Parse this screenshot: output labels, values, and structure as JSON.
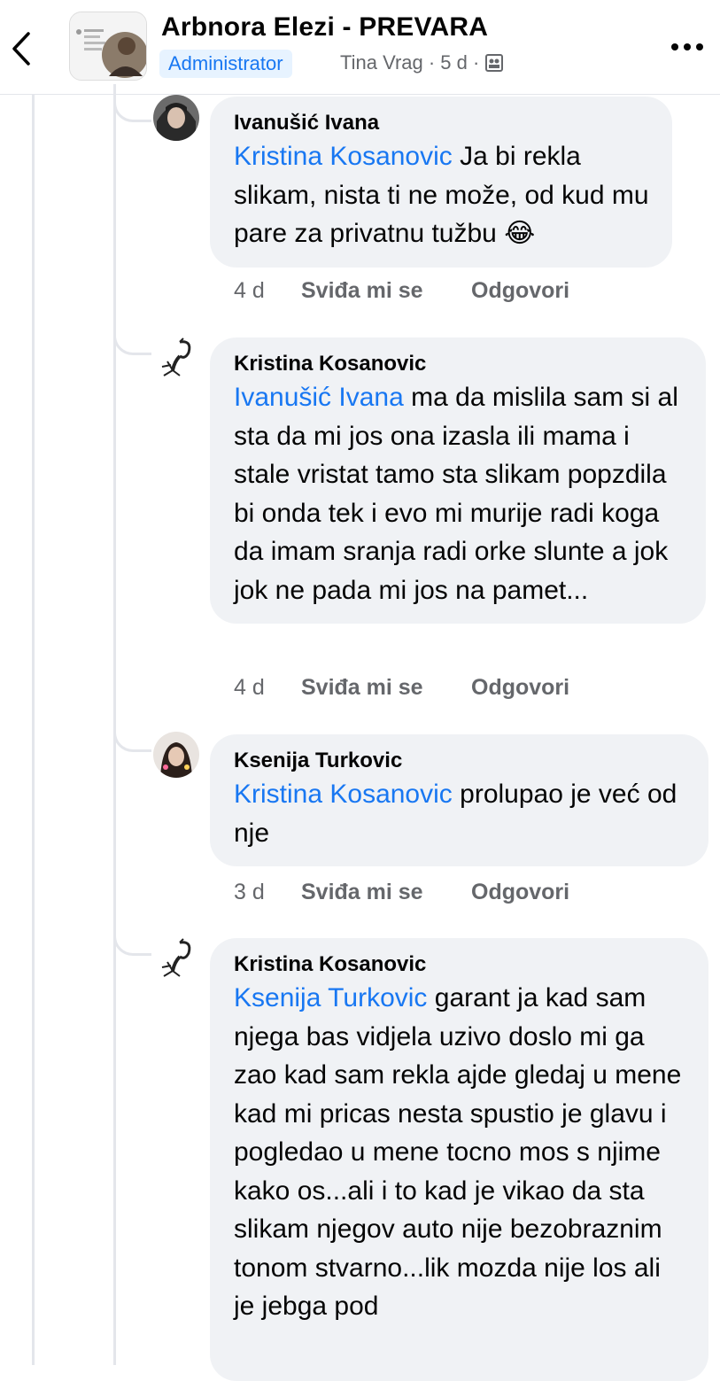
{
  "header": {
    "title": "Arbnora Elezi - PREVARA",
    "badge": "Administrator",
    "meta": "Tina Vrag · 5 d ·",
    "back_icon": "chevron-left-icon",
    "more_icon": "ellipsis-icon",
    "audience_icon": "members-icon"
  },
  "colors": {
    "link": "#1877f2",
    "bubble": "#f0f2f5",
    "muted": "#65676b"
  },
  "comments": [
    {
      "author": "Ivanušić Ivana",
      "mention": "Kristina Kosanovic",
      "text": "Ja bi rekla slikam, nista ti ne može, od kud mu pare za privatnu tužbu",
      "emoji": "😂",
      "time": "4 d",
      "like": "Sviđa mi se",
      "reply": "Odgovori"
    },
    {
      "author": "Kristina Kosanovic",
      "mention": "Ivanušić Ivana",
      "text": "ma da mislila sam si al sta da mi jos ona izasla ili mama i stale vristat tamo sta slikam popzdila bi onda tek i evo mi murije radi koga da imam sranja radi orke slunte a jok jok ne pada mi jos na pamet...",
      "time": "4 d",
      "like": "Sviđa mi se",
      "reply": "Odgovori"
    },
    {
      "author": "Ksenija Turkovic",
      "mention": "Kristina Kosanovic",
      "text": "prolupao je već od nje",
      "time": "3 d",
      "like": "Sviđa mi se",
      "reply": "Odgovori"
    },
    {
      "author": "Kristina Kosanovic",
      "mention": "Ksenija Turkovic",
      "text": "garant ja kad sam njega bas vidjela uzivo doslo mi ga zao kad sam rekla ajde gledaj u mene kad mi pricas nesta spustio je glavu i pogledao u mene tocno mos s njime kako os...ali i to kad je vikao da sta slikam njegov auto nije bezobraznim tonom stvarno...lik mozda nije los ali je jebga pod"
    }
  ]
}
